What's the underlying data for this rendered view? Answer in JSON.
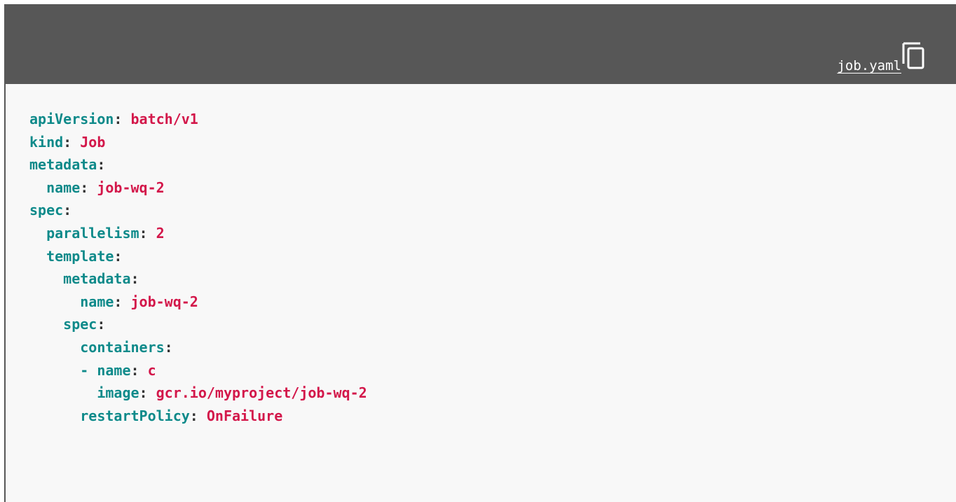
{
  "header": {
    "filename": "job.yaml",
    "copy_icon": "copy-icon"
  },
  "colors": {
    "header_bg": "#575757",
    "code_bg": "#f8f8f8",
    "key": "#0e8a8a",
    "value": "#d3174a"
  },
  "code_lines": [
    {
      "indent": "",
      "dash": "",
      "key": "apiVersion",
      "value": "batch/v1"
    },
    {
      "indent": "",
      "dash": "",
      "key": "kind",
      "value": "Job"
    },
    {
      "indent": "",
      "dash": "",
      "key": "metadata",
      "value": ""
    },
    {
      "indent": "  ",
      "dash": "",
      "key": "name",
      "value": "job-wq-2"
    },
    {
      "indent": "",
      "dash": "",
      "key": "spec",
      "value": ""
    },
    {
      "indent": "  ",
      "dash": "",
      "key": "parallelism",
      "value": "2"
    },
    {
      "indent": "  ",
      "dash": "",
      "key": "template",
      "value": ""
    },
    {
      "indent": "    ",
      "dash": "",
      "key": "metadata",
      "value": ""
    },
    {
      "indent": "      ",
      "dash": "",
      "key": "name",
      "value": "job-wq-2"
    },
    {
      "indent": "    ",
      "dash": "",
      "key": "spec",
      "value": ""
    },
    {
      "indent": "      ",
      "dash": "",
      "key": "containers",
      "value": ""
    },
    {
      "indent": "      ",
      "dash": "- ",
      "key": "name",
      "value": "c"
    },
    {
      "indent": "        ",
      "dash": "",
      "key": "image",
      "value": "gcr.io/myproject/job-wq-2"
    },
    {
      "indent": "      ",
      "dash": "",
      "key": "restartPolicy",
      "value": "OnFailure"
    }
  ]
}
